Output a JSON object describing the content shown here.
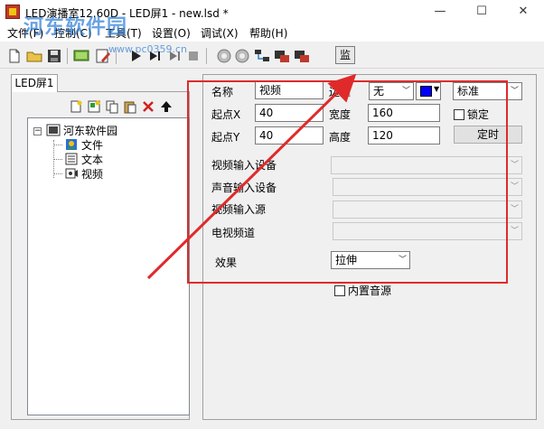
{
  "window": {
    "title": "LED演播室12.60D - LED屏1 - new.lsd *",
    "minimize": "—",
    "maximize": "☐",
    "close": "✕"
  },
  "watermark": {
    "text": "河东软件园",
    "url": "www.pc0359.cn"
  },
  "menu": {
    "items": [
      "文件(F)",
      "控制(C)",
      "工具(T)",
      "设置(O)",
      "调试(X)",
      "帮助(H)"
    ]
  },
  "toolbar": {
    "monitor_label": "监"
  },
  "left": {
    "tab_label": "LED屏1",
    "tree": {
      "root": "河东软件园",
      "children": [
        "文件",
        "文本",
        "视频"
      ]
    }
  },
  "props": {
    "name_label": "名称",
    "name_value": "视频",
    "border_label": "边框",
    "border_value": "无",
    "border_color": "#0000ff",
    "style_value": "标准",
    "x_label": "起点X",
    "x_value": "40",
    "width_label": "宽度",
    "width_value": "160",
    "lock_label": "锁定",
    "y_label": "起点Y",
    "y_value": "40",
    "height_label": "高度",
    "height_value": "120",
    "timer_button": "定时",
    "video_device_label": "视频输入设备",
    "audio_device_label": "声音输入设备",
    "video_source_label": "视频输入源",
    "tv_channel_label": "电视频道",
    "effect_label": "效果",
    "effect_value": "拉伸",
    "internal_audio_label": "内置音源"
  }
}
